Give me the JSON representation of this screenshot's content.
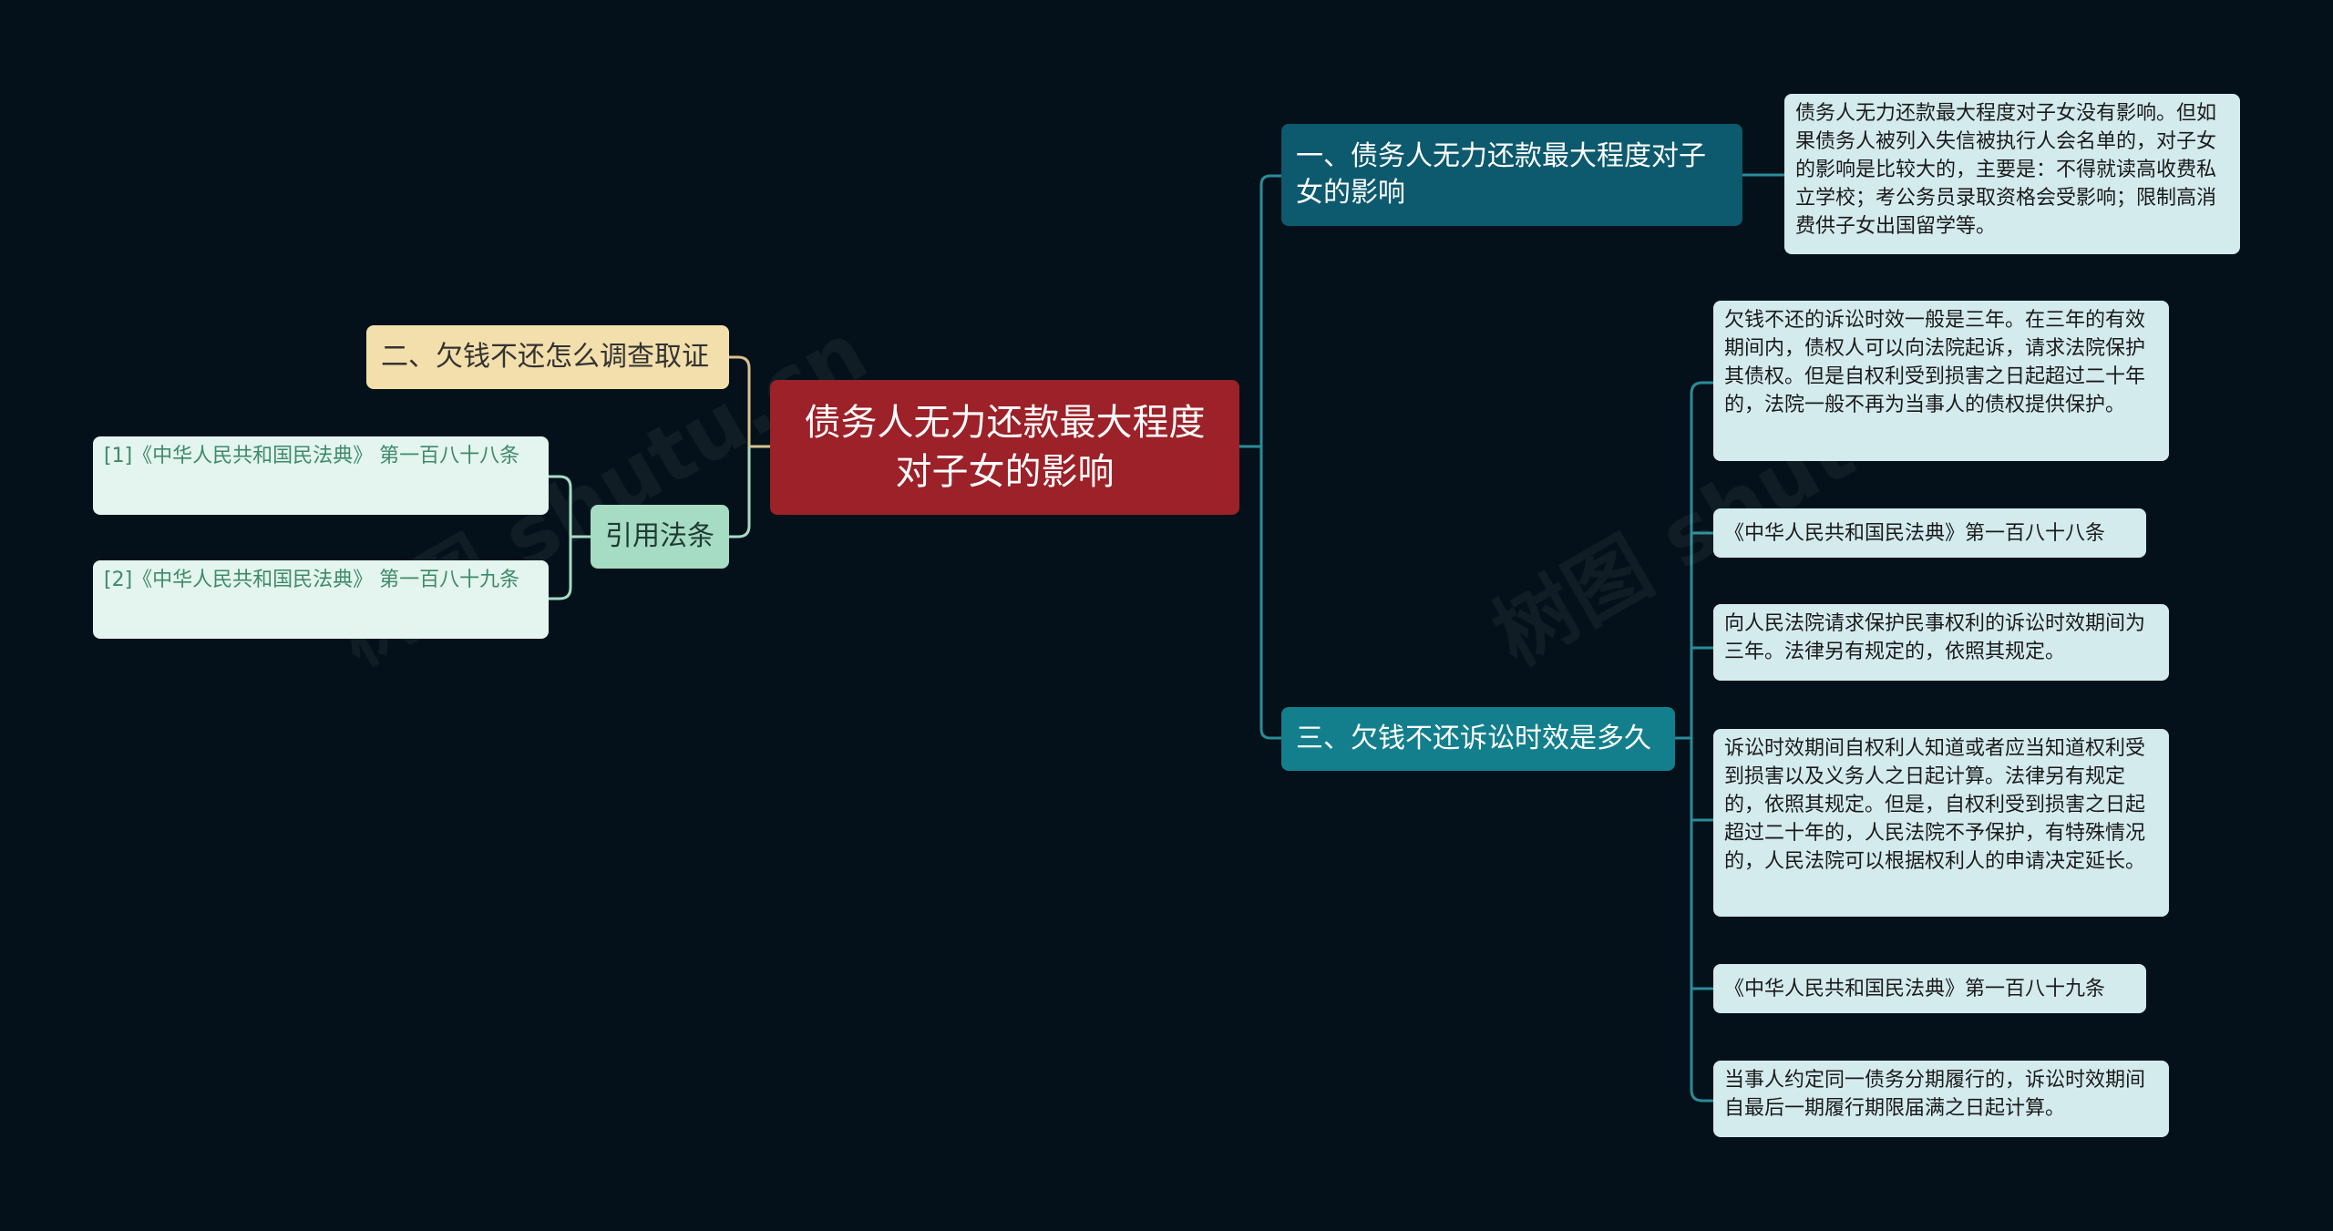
{
  "root": {
    "label": "债务人无力还款最大程度对子女的影响"
  },
  "branch1": {
    "label": "一、债务人无力还款最大程度对子女的影响",
    "detail": "债务人无力还款最大程度对子女没有影响。但如果债务人被列入失信被执行人会名单的，对子女的影响是比较大的，主要是：不得就读高收费私立学校；考公务员录取资格会受影响；限制高消费供子女出国留学等。"
  },
  "branch2": {
    "label": "二、欠钱不还怎么调查取证"
  },
  "branch_refs": {
    "label": "引用法条",
    "items": [
      "[1]《中华人民共和国民法典》 第一百八十八条",
      "[2]《中华人民共和国民法典》 第一百八十九条"
    ]
  },
  "branch3": {
    "label": "三、欠钱不还诉讼时效是多久",
    "details": [
      "欠钱不还的诉讼时效一般是三年。在三年的有效期间内，债权人可以向法院起诉，请求法院保护其债权。但是自权利受到损害之日起超过二十年的，法院一般不再为当事人的债权提供保护。",
      "《中华人民共和国民法典》第一百八十八条",
      "向人民法院请求保护民事权利的诉讼时效期间为三年。法律另有规定的，依照其规定。",
      "诉讼时效期间自权利人知道或者应当知道权利受到损害以及义务人之日起计算。法律另有规定的，依照其规定。但是，自权利受到损害之日起超过二十年的，人民法院不予保护，有特殊情况的，人民法院可以根据权利人的申请决定延长。",
      "《中华人民共和国民法典》第一百八十九条",
      "当事人约定同一债务分期履行的，诉讼时效期间自最后一期履行期限届满之日起计算。"
    ]
  },
  "watermark": {
    "text": "树图 shutu.cn"
  },
  "colors": {
    "background": "#04111a",
    "root": "#9c2128",
    "branch1": "#0d5a6e",
    "branch3": "#137f8c",
    "branch2": "#f3dfab",
    "refs": "#a6dcc4",
    "leaf": "#d4ebee",
    "connector": "#2a8c98"
  }
}
